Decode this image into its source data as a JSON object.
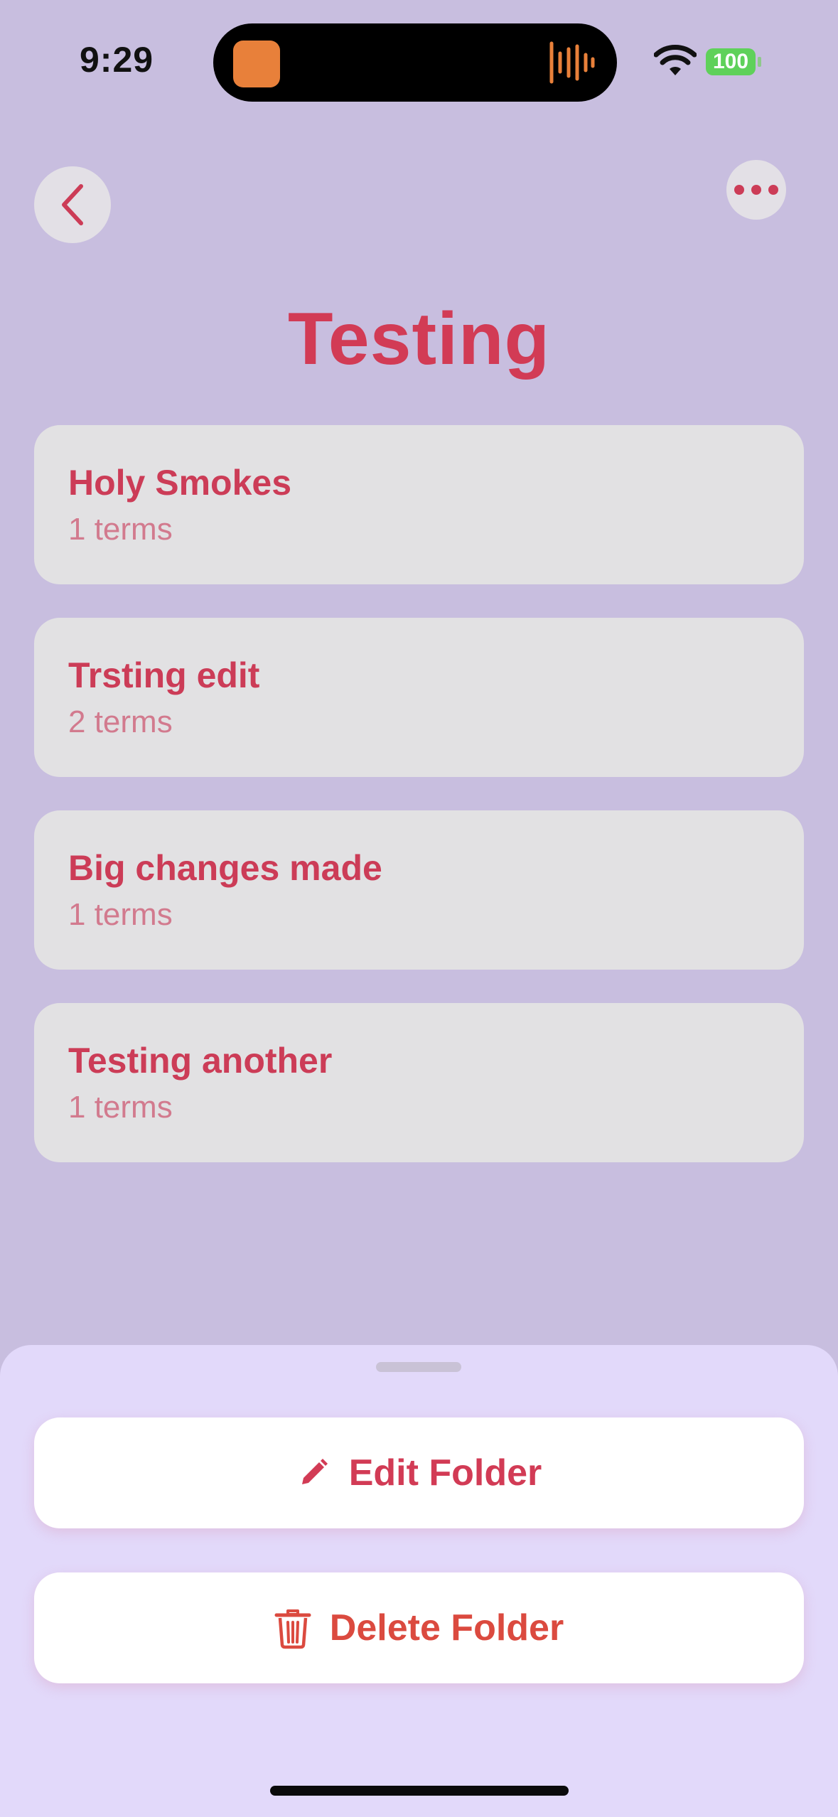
{
  "status_bar": {
    "time": "9:29",
    "battery": "100"
  },
  "header": {
    "title": "Testing",
    "back_icon": "chevron-left-icon",
    "more_icon": "ellipsis-icon"
  },
  "sets": [
    {
      "name": "Holy Smokes",
      "count": "1 terms"
    },
    {
      "name": "Trsting edit",
      "count": "2 terms"
    },
    {
      "name": "Big changes made",
      "count": "1 terms"
    },
    {
      "name": "Testing another",
      "count": "1 terms"
    }
  ],
  "sheet": {
    "edit_label": "Edit Folder",
    "edit_icon": "pencil-icon",
    "delete_label": "Delete Folder",
    "delete_icon": "trash-icon"
  },
  "colors": {
    "background": "#c8bedf",
    "accent": "#d23b55",
    "card": "#e2e1e3",
    "sheet": "#e2d9fa",
    "delete": "#db4a3f"
  }
}
